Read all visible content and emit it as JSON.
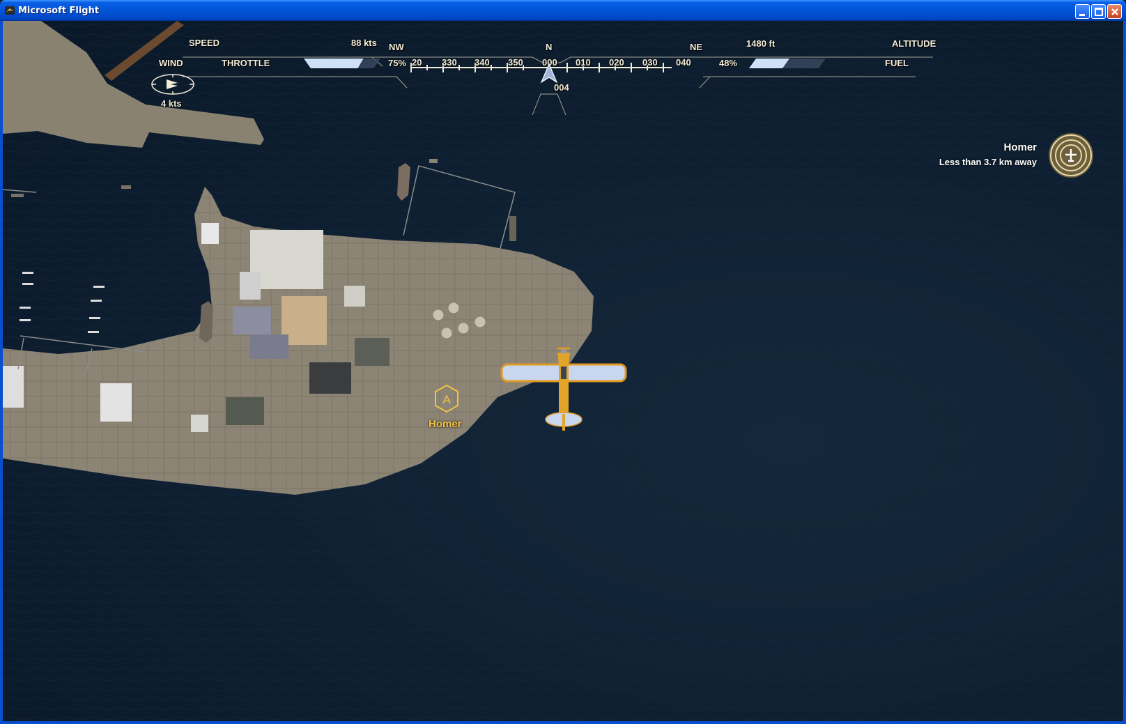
{
  "window": {
    "title": "Microsoft Flight"
  },
  "hud": {
    "speed_label": "SPEED",
    "speed_value": "88 kts",
    "throttle_label": "THROTTLE",
    "throttle_value": "75%",
    "throttle_fraction": 0.75,
    "wind_label": "WIND",
    "wind_value": "4  kts",
    "altitude_value": "1480 ft",
    "altitude_label": "ALTITUDE",
    "fuel_label": "FUEL",
    "fuel_value": "48%",
    "fuel_fraction": 0.48
  },
  "compass": {
    "cardinals": {
      "nw": "NW",
      "n": "N",
      "ne": "NE"
    },
    "ticks": [
      "20",
      "330",
      "340",
      "350",
      "000",
      "010",
      "020",
      "030",
      "040"
    ],
    "heading": "004"
  },
  "waypoint": {
    "letter": "A",
    "name": "Homer"
  },
  "destination": {
    "name": "Homer",
    "distance": "Less than 3.7 km away"
  },
  "colors": {
    "hud_text": "#f2ecd8",
    "waypoint": "#f2c240",
    "water": "#0e1f31",
    "land": "#8a8272"
  }
}
